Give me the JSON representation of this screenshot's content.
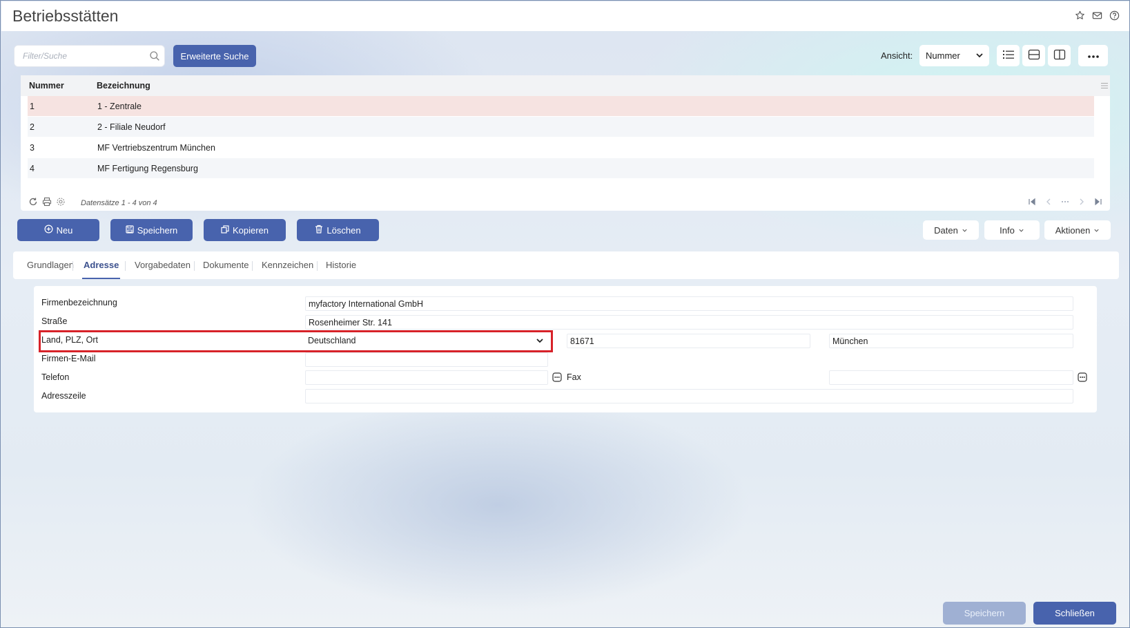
{
  "page": {
    "title": "Betriebsstätten"
  },
  "header_icons": [
    "star-icon",
    "mail-icon",
    "help-icon"
  ],
  "toolbar": {
    "search_placeholder": "Filter/Suche",
    "search_value": "",
    "extended_search_label": "Erweiterte Suche",
    "view_label": "Ansicht:",
    "view_value": "Nummer"
  },
  "grid": {
    "columns": [
      "Nummer",
      "Bezeichnung"
    ],
    "rows": [
      {
        "nummer": "1",
        "bezeichnung": "1 - Zentrale",
        "selected": true
      },
      {
        "nummer": "2",
        "bezeichnung": "2 - Filiale Neudorf"
      },
      {
        "nummer": "3",
        "bezeichnung": "MF Vertriebszentrum München"
      },
      {
        "nummer": "4",
        "bezeichnung": "MF Fertigung Regensburg"
      }
    ],
    "record_count": "Datensätze 1 - 4 von 4"
  },
  "actions": {
    "new_label": "Neu",
    "save_label": "Speichern",
    "copy_label": "Kopieren",
    "delete_label": "Löschen",
    "data_label": "Daten",
    "info_label": "Info",
    "actions_label": "Aktionen"
  },
  "tabs": [
    {
      "label": "Grundlagen"
    },
    {
      "label": "Adresse",
      "active": true
    },
    {
      "label": "Vorgabedaten"
    },
    {
      "label": "Dokumente"
    },
    {
      "label": "Kennzeichen"
    },
    {
      "label": "Historie"
    }
  ],
  "form": {
    "firm_label": "Firmenbezeichnung",
    "firm_value": "myfactory International GmbH",
    "street_label": "Straße",
    "street_value": "Rosenheimer Str. 141",
    "country_label": "Land, PLZ, Ort",
    "country_value": "Deutschland",
    "zip_value": "81671",
    "city_value": "München",
    "email_label": "Firmen-E-Mail",
    "email_value": "",
    "phone_label": "Telefon",
    "phone_value": "",
    "fax_label": "Fax",
    "fax_value": "",
    "addressline_label": "Adresszeile",
    "addressline_value": ""
  },
  "footer": {
    "save_label": "Speichern",
    "close_label": "Schließen"
  },
  "colors": {
    "primary": "#4863ad",
    "highlight_border": "#d72229",
    "selected_row": "#f6e3e1"
  }
}
